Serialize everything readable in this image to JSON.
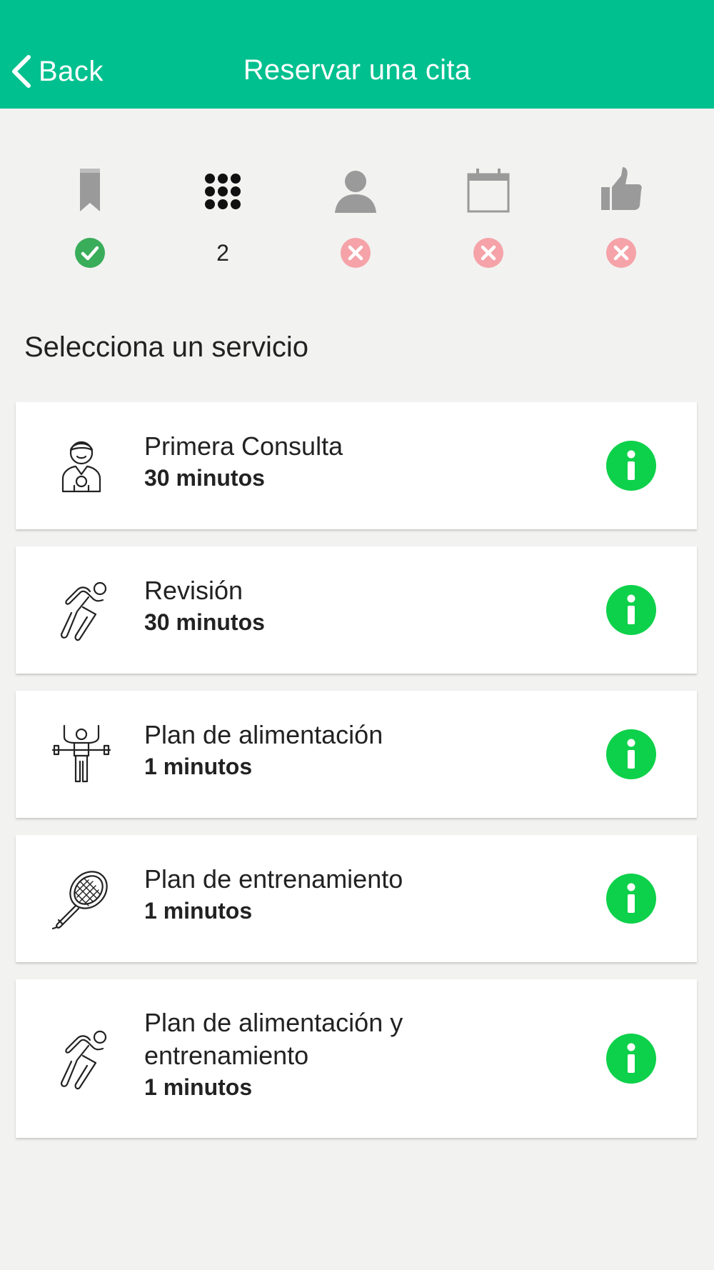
{
  "header": {
    "back_label": "Back",
    "title": "Reservar una cita",
    "color": "#00c08f"
  },
  "steps": [
    {
      "icon": "bookmark-icon",
      "status": "completed"
    },
    {
      "icon": "grid-icon",
      "status": "current",
      "number": "2"
    },
    {
      "icon": "person-icon",
      "status": "pending"
    },
    {
      "icon": "calendar-icon",
      "status": "pending"
    },
    {
      "icon": "thumbs-up-icon",
      "status": "pending"
    }
  ],
  "section_title": "Selecciona un servicio",
  "services": [
    {
      "name": "Primera Consulta",
      "duration": "30 minutos",
      "icon": "nutritionist-icon"
    },
    {
      "name": "Revisión",
      "duration": "30 minutos",
      "icon": "runner-icon"
    },
    {
      "name": "Plan de alimentación",
      "duration": "1 minutos",
      "icon": "weightlifter-icon"
    },
    {
      "name": "Plan de entrenamiento",
      "duration": "1 minutos",
      "icon": "tennis-racket-icon"
    },
    {
      "name": "Plan de alimentación y entrenamiento",
      "duration": "1 minutos",
      "icon": "runner-icon"
    }
  ],
  "colors": {
    "completed": "#3aad5a",
    "pending": "#f5a3a8",
    "info": "#0dd14a"
  }
}
